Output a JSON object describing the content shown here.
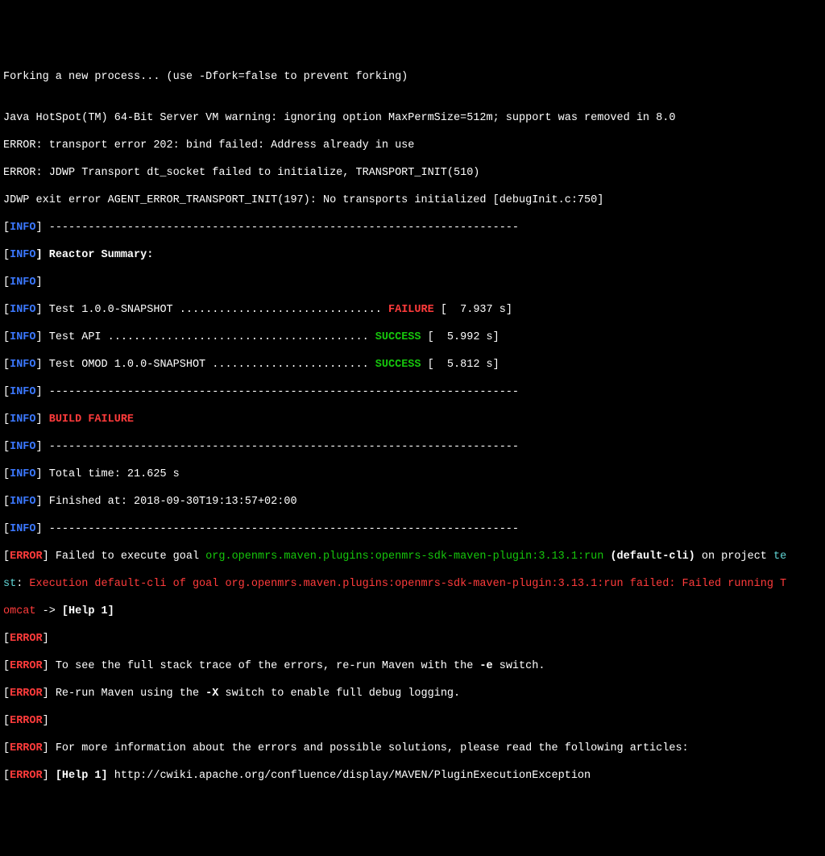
{
  "lines": {
    "l0": "Forking a new process... (use -Dfork=false to prevent forking)",
    "blank": "",
    "l2": "Java HotSpot(TM) 64-Bit Server VM warning: ignoring option MaxPermSize=512m; support was removed in 8.0",
    "l3": "ERROR: transport error 202: bind failed: Address already in use",
    "l4": "ERROR: JDWP Transport dt_socket failed to initialize, TRANSPORT_INIT(510)",
    "l5": "JDWP exit error AGENT_ERROR_TRANSPORT_INIT(197): No transports initialized [debugInit.c:750]"
  },
  "tags": {
    "info": "INFO",
    "error": "ERROR"
  },
  "separator": "] ------------------------------------------------------------------------",
  "reactor_header": "] Reactor Summary:",
  "empty_bracket": "]",
  "reactor": {
    "r1_pre": "] Test 1.0.0-SNAPSHOT ............................... ",
    "r1_status": "FAILURE",
    "r1_post": " [  7.937 s]",
    "r2_pre": "] Test API ........................................ ",
    "r2_status": "SUCCESS",
    "r2_post": " [  5.992 s]",
    "r3_pre": "] Test OMOD 1.0.0-SNAPSHOT ........................ ",
    "r3_status": "SUCCESS",
    "r3_post": " [  5.812 s]"
  },
  "build_failure_pre": "] ",
  "build_failure": "BUILD FAILURE",
  "total_time": "] Total time: 21.625 s",
  "finished_at": "] Finished at: 2018-09-30T19:13:57+02:00",
  "err1": {
    "a": "] Failed to execute goal ",
    "b": "org.openmrs.maven.plugins:openmrs-sdk-maven-plugin:3.13.1:run",
    "c": " (default-cli)",
    "d": " on project ",
    "e": "te"
  },
  "err2": {
    "a": "st",
    "b": ": ",
    "c": "Execution default-cli of goal org.openmrs.maven.plugins:openmrs-sdk-maven-plugin:3.13.1:run failed: Failed running T"
  },
  "err3": {
    "a": "omcat",
    "b": " -> ",
    "c": "[Help 1]"
  },
  "err_trace": {
    "a": "] To see the full stack trace of the errors, re-run Maven with the ",
    "b": "-e",
    "c": " switch."
  },
  "err_rerun": {
    "a": "] Re-run Maven using the ",
    "b": "-X",
    "c": " switch to enable full debug logging."
  },
  "err_more": "] For more information about the errors and possible solutions, please read the following articles:",
  "err_help": {
    "a": "] ",
    "b": "[Help 1]",
    "c": " http://cwiki.apache.org/confluence/display/MAVEN/PluginExecutionException"
  },
  "bracket_open": "[",
  "bracket_close_space": "] "
}
